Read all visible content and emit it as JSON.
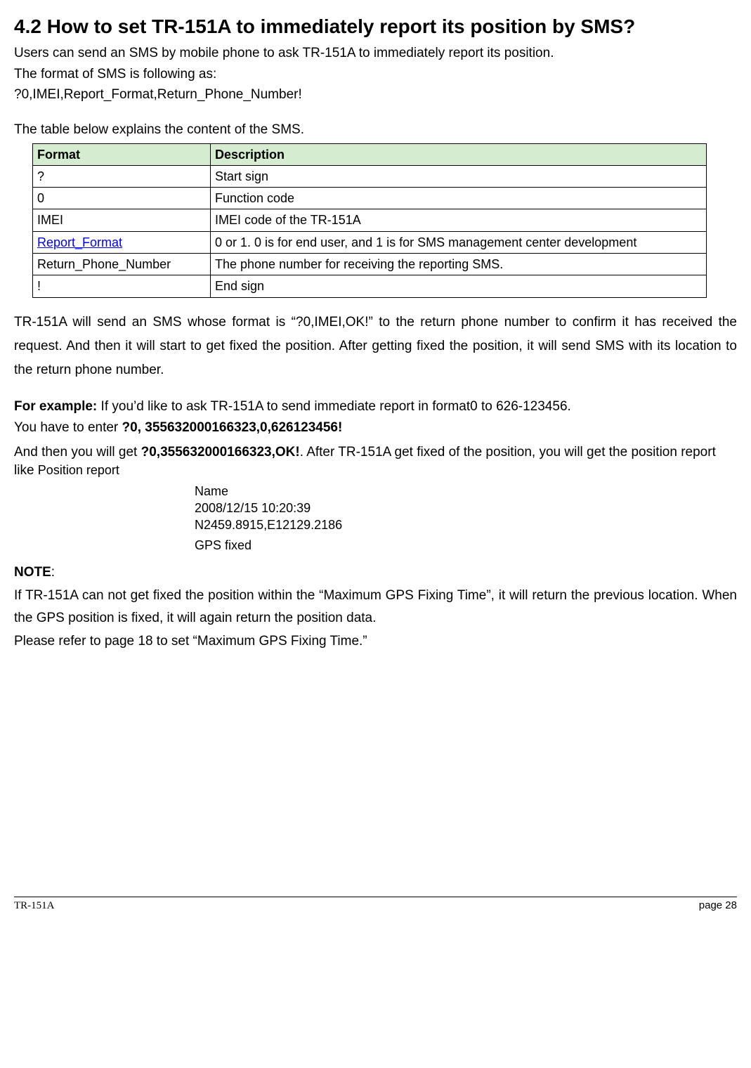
{
  "heading": "4.2 How to set TR-151A to immediately report its position by SMS?",
  "intro": {
    "p1": "Users can send an SMS by mobile phone to ask TR-151A to immediately report its position.",
    "p2": "The format of SMS is following as:",
    "p3": "?0,IMEI,Report_Format,Return_Phone_Number!"
  },
  "tableIntro": "The table below explains the content of the SMS.",
  "table": {
    "headers": {
      "col1": "Format",
      "col2": "Description"
    },
    "rows": [
      {
        "format": "?",
        "desc": "Start sign",
        "link": false
      },
      {
        "format": "0",
        "desc": "Function code",
        "link": false
      },
      {
        "format": "IMEI",
        "desc": "IMEI code of the TR-151A",
        "link": false
      },
      {
        "format": "Report_Format",
        "desc": "0 or 1. 0 is for end user, and 1 is for SMS management center development",
        "link": true
      },
      {
        "format": "Return_Phone_Number",
        "desc": "The phone number for receiving the reporting SMS.",
        "link": false
      },
      {
        "format": "!",
        "desc": "End sign",
        "link": false
      }
    ]
  },
  "confirmPara": "TR-151A will send an SMS whose format is “?0,IMEI,OK!” to the return phone number to confirm it has received the request. And then it will start to get fixed the position. After getting fixed the position, it will send SMS with its location to the return phone number.",
  "example": {
    "label": "For example:",
    "line1rest": " If you’d like to ask TR-151A to send immediate report in format0 to 626-123456.",
    "line2pre": "You have to enter ",
    "line2bold": "?0, 355632000166323,0,626123456!",
    "line3pre": "And then you will get ",
    "line3bold": "?0,355632000166323,OK!",
    "line3post": ". After TR-151A get fixed of the position, you will get the position report like ",
    "report": {
      "l1": "Position report",
      "l2": "Name",
      "l3": "2008/12/15 10:20:39",
      "l4": "N2459.8915,E12129.2186",
      "l5": "GPS fixed"
    }
  },
  "note": {
    "label": "NOTE",
    "colon": ":",
    "body1": "If TR-151A can not get fixed the position within the “Maximum GPS Fixing Time”, it will return the previous location. When the GPS position is fixed, it will again return the position data.",
    "body2": "Please refer to page 18 to set “Maximum GPS Fixing Time.”"
  },
  "footer": {
    "left": "TR-151A",
    "right": "page 28"
  }
}
